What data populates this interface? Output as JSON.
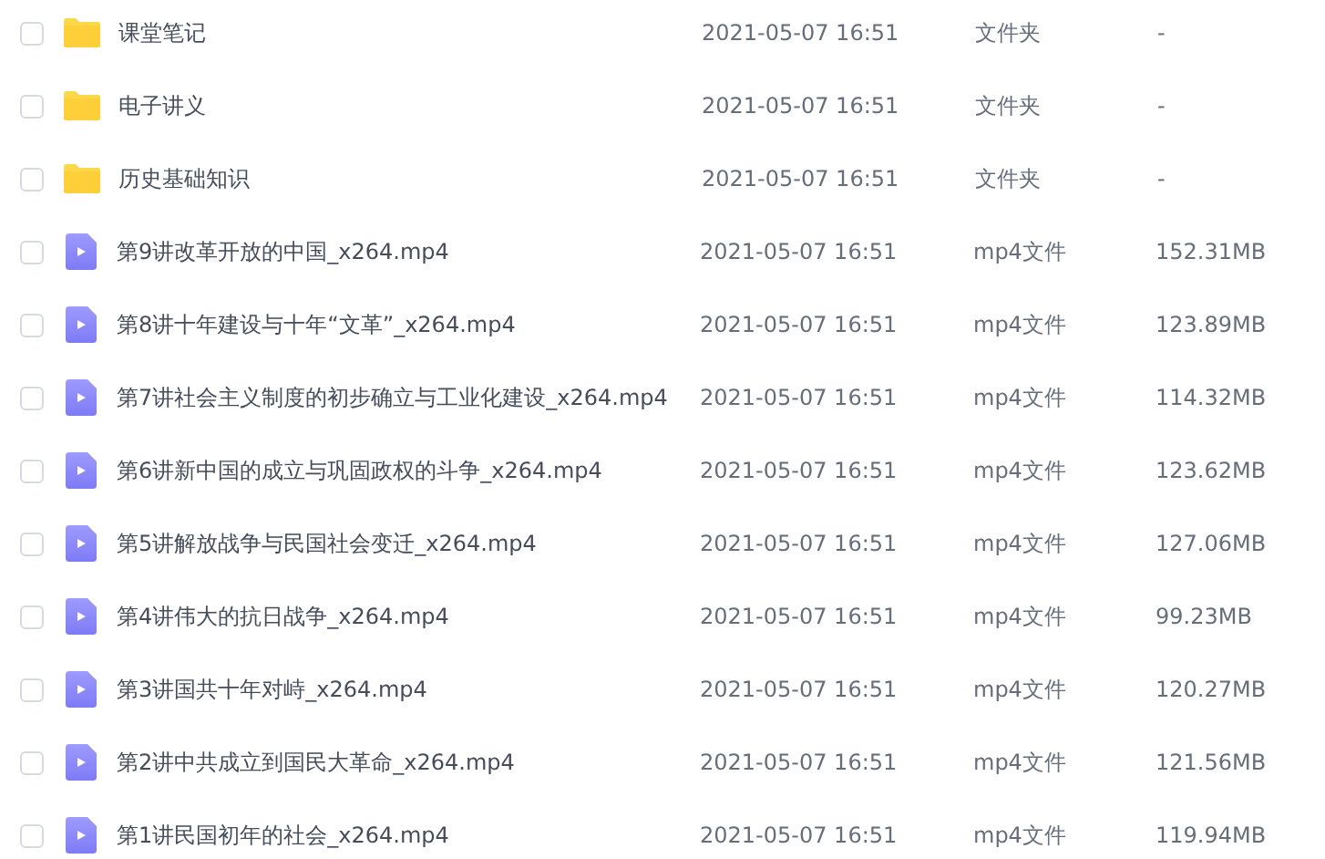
{
  "files": [
    {
      "kind": "folder",
      "checked": false,
      "name": "课堂笔记",
      "modified": "2021-05-07 16:51",
      "type": "文件夹",
      "size": "-"
    },
    {
      "kind": "folder",
      "checked": false,
      "name": "电子讲义",
      "modified": "2021-05-07 16:51",
      "type": "文件夹",
      "size": "-"
    },
    {
      "kind": "folder",
      "checked": false,
      "name": "历史基础知识",
      "modified": "2021-05-07 16:51",
      "type": "文件夹",
      "size": "-"
    },
    {
      "kind": "video",
      "checked": false,
      "name": "第9讲改革开放的中国_x264.mp4",
      "modified": "2021-05-07 16:51",
      "type": "mp4文件",
      "size": "152.31MB"
    },
    {
      "kind": "video",
      "checked": false,
      "name": "第8讲十年建设与十年“文革”_x264.mp4",
      "modified": "2021-05-07 16:51",
      "type": "mp4文件",
      "size": "123.89MB"
    },
    {
      "kind": "video",
      "checked": false,
      "name": "第7讲社会主义制度的初步确立与工业化建设_x264.mp4",
      "modified": "2021-05-07 16:51",
      "type": "mp4文件",
      "size": "114.32MB"
    },
    {
      "kind": "video",
      "checked": false,
      "name": "第6讲新中国的成立与巩固政权的斗争_x264.mp4",
      "modified": "2021-05-07 16:51",
      "type": "mp4文件",
      "size": "123.62MB"
    },
    {
      "kind": "video",
      "checked": false,
      "name": "第5讲解放战争与民国社会变迁_x264.mp4",
      "modified": "2021-05-07 16:51",
      "type": "mp4文件",
      "size": "127.06MB"
    },
    {
      "kind": "video",
      "checked": false,
      "name": "第4讲伟大的抗日战争_x264.mp4",
      "modified": "2021-05-07 16:51",
      "type": "mp4文件",
      "size": "99.23MB"
    },
    {
      "kind": "video",
      "checked": false,
      "name": "第3讲国共十年对峙_x264.mp4",
      "modified": "2021-05-07 16:51",
      "type": "mp4文件",
      "size": "120.27MB"
    },
    {
      "kind": "video",
      "checked": false,
      "name": "第2讲中共成立到国民大革命_x264.mp4",
      "modified": "2021-05-07 16:51",
      "type": "mp4文件",
      "size": "121.56MB"
    },
    {
      "kind": "video",
      "checked": false,
      "name": "第1讲民国初年的社会_x264.mp4",
      "modified": "2021-05-07 16:51",
      "type": "mp4文件",
      "size": "119.94MB"
    }
  ]
}
